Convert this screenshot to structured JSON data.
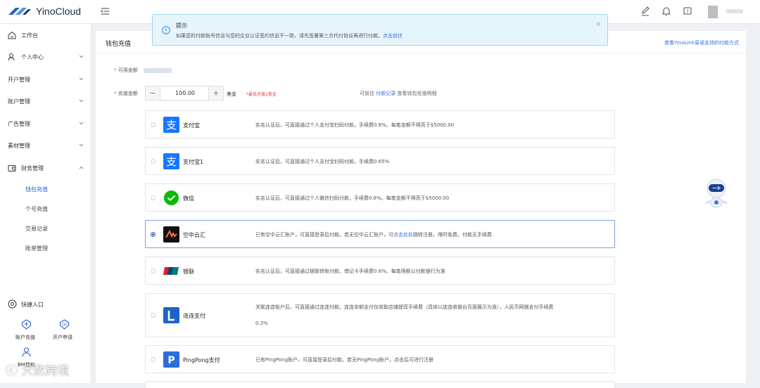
{
  "app": {
    "name": "YinoCloud"
  },
  "sidebar": {
    "workbench": "工作台",
    "personal_center": "个人中心",
    "account_opening": "开户管理",
    "account_management": "账户管理",
    "ad_management": "广告管理",
    "asset_management": "素材管理",
    "finance": "财务管理",
    "finance_sub": [
      "钱包充值",
      "个号充值",
      "交易记录",
      "账单管理"
    ],
    "quick_entry": "快捷入口",
    "quick_items": [
      "账户充值",
      "开户申请",
      "BM授权"
    ]
  },
  "page": {
    "title": "钱包充值",
    "supported_methods_link": "查看YinoLink易诺支持的付款方式",
    "available_label": "可用金额",
    "recharge_label": "充值金额",
    "amount": "100.00",
    "unit": "美金",
    "min_hint": "*最低充值1美金",
    "record_prefix": "可前往",
    "record_link": "付款记录",
    "record_suffix": "查看钱包充值明细"
  },
  "payments": [
    {
      "name": "支付宝",
      "desc": "实名认证后，可直接通过个人支付宝扫码付款，手续费0.8%。每笔金额不得高于$5000.00",
      "selected": false
    },
    {
      "name": "支付宝1",
      "desc": "实名认证后，可直接通过个人支付宝扫码付款，手续费0.65%",
      "selected": false
    },
    {
      "name": "微信",
      "desc": "实名认证后，可直接通过个人微信扫码付款，手续费0.8%。每笔金额不得高于$5000.00",
      "selected": false
    },
    {
      "name": "空中云汇",
      "desc_before": "已有空中云汇账户，可直接登录后付款。若无空中云汇账户，可",
      "desc_link": "点击此处",
      "desc_after": "跳转注册。限时免费，付款无手续费",
      "selected": true
    },
    {
      "name": "银联",
      "desc": "实名认证后，可直接通过银联转账付款，借记卡手续费0.8%。每笔限额以付款银行为准",
      "selected": false
    },
    {
      "name": "连连支付",
      "desc_line1": "关联连连账户后，可直接通过连连付款。连连余额支付仅收取店铺提现手续费（具体以连连收银台页面展示为准），人民币网银支付手续费",
      "desc_line2": "0.3%",
      "selected": false
    },
    {
      "name": "PingPong支付",
      "desc": "已有PingPong账户，可直接登录后付款。若无PingPong账户，点击后可进行注册",
      "selected": false
    }
  ],
  "alert": {
    "title": "提示",
    "message": "如果您的付款账号信息与您的企业认证签约信息不一致，请先签署第三方代付协议再进行付款。",
    "link": "点击前往"
  },
  "watermark": "大数跨境",
  "colors": {
    "accent": "#2a5bd7",
    "link": "#3a6fd8",
    "alert_bg": "#e6f4fc",
    "required": "#e04343"
  }
}
